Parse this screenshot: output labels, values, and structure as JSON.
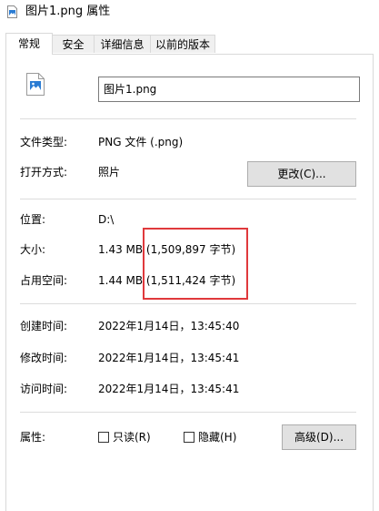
{
  "window": {
    "title": "图片1.png 属性"
  },
  "tabs": [
    {
      "label": "常规",
      "active": true
    },
    {
      "label": "安全",
      "active": false
    },
    {
      "label": "详细信息",
      "active": false
    },
    {
      "label": "以前的版本",
      "active": false
    }
  ],
  "general": {
    "file_name": "图片1.png",
    "type_label": "文件类型:",
    "type_value": "PNG 文件 (.png)",
    "opens_with_label": "打开方式:",
    "opens_with_value": "照片",
    "change_button": "更改(C)...",
    "location_label": "位置:",
    "location_value": "D:\\",
    "size_label": "大小:",
    "size_value": "1.43 MB (1,509,897 字节)",
    "size_on_disk_label": "占用空间:",
    "size_on_disk_value": "1.44 MB (1,511,424 字节)",
    "created_label": "创建时间:",
    "created_value": "2022年1月14日，13:45:40",
    "modified_label": "修改时间:",
    "modified_value": "2022年1月14日，13:45:41",
    "accessed_label": "访问时间:",
    "accessed_value": "2022年1月14日，13:45:41",
    "attributes_label": "属性:",
    "readonly_label": "只读(R)",
    "readonly_checked": false,
    "hidden_label": "隐藏(H)",
    "hidden_checked": false,
    "advanced_button": "高级(D)..."
  },
  "annotation": {
    "highlight_color": "#e0393c"
  }
}
